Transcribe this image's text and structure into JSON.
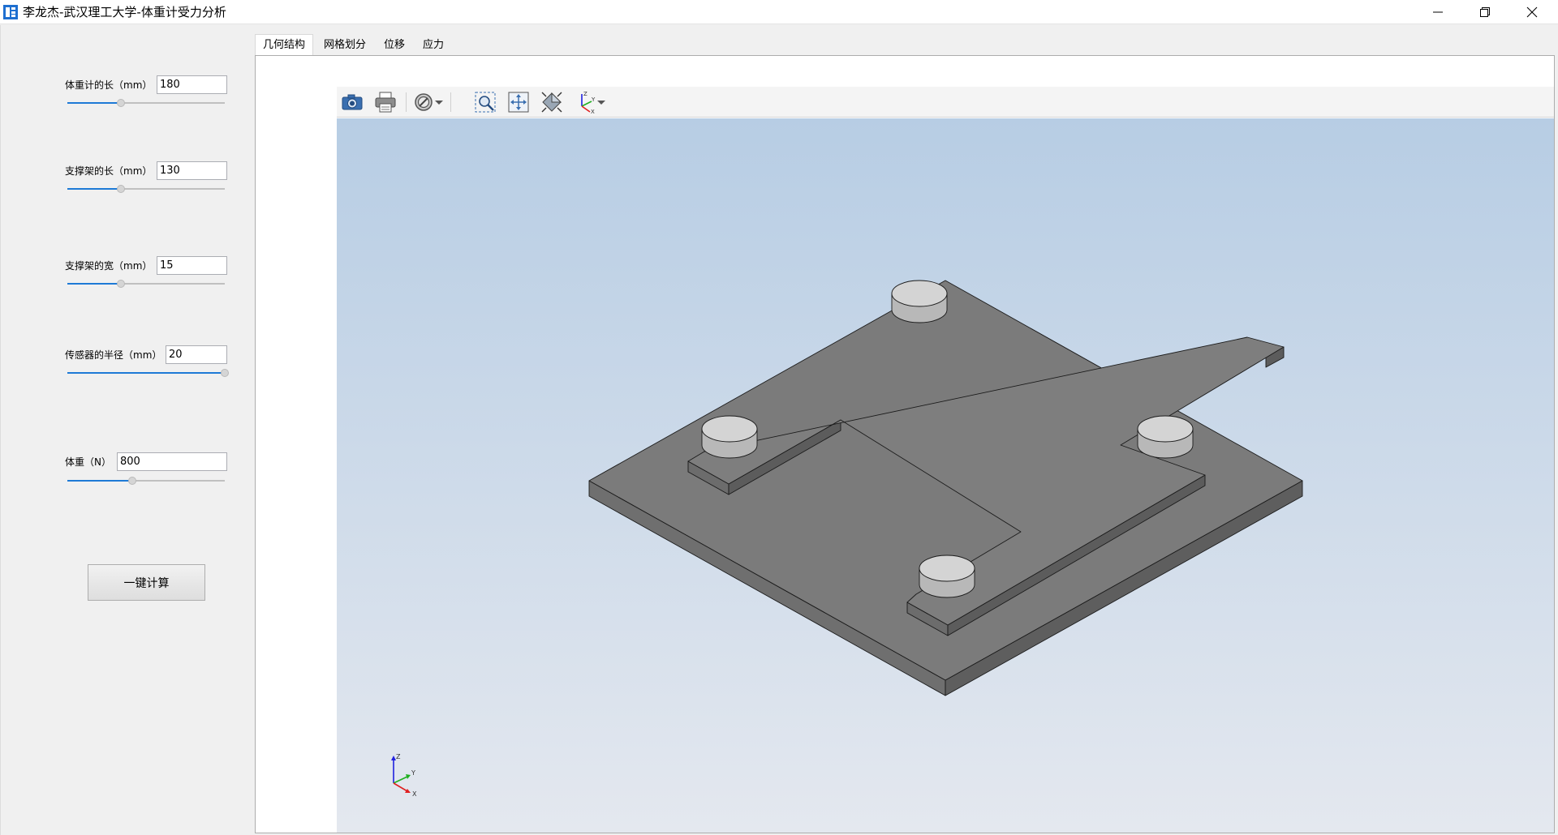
{
  "window": {
    "title": "李龙杰-武汉理工大学-体重计受力分析",
    "controls": {
      "minimize": "minimize",
      "maximize": "restore",
      "close": "close"
    }
  },
  "params": [
    {
      "label": "体重计的长（mm）",
      "value": "180",
      "slider_fraction": 0.34
    },
    {
      "label": "支撑架的长（mm）",
      "value": "130",
      "slider_fraction": 0.34
    },
    {
      "label": "支撑架的宽（mm）",
      "value": "15",
      "slider_fraction": 0.34
    },
    {
      "label": "传感器的半径（mm）",
      "value": "20",
      "slider_fraction": 1.0
    },
    {
      "label": "体重（N）",
      "value": "800",
      "slider_fraction": 0.41
    }
  ],
  "calc_button": {
    "label": "一键计算"
  },
  "tabs": [
    {
      "label": "几何结构",
      "active": true
    },
    {
      "label": "网格划分",
      "active": false
    },
    {
      "label": "位移",
      "active": false
    },
    {
      "label": "应力",
      "active": false
    }
  ],
  "viewer": {
    "toolbar": [
      "camera-icon",
      "print-icon",
      "clip-plane-icon",
      "dropdown-arrow-icon",
      "zoom-box-icon",
      "fit-all-icon",
      "isometric-view-icon",
      "axes-view-icon",
      "dropdown-arrow-icon"
    ],
    "axis_labels": {
      "x": "X",
      "y": "Y",
      "z": "Z"
    },
    "colors": {
      "background_top": "#b7cde4",
      "background_bottom": "#e4e8ef",
      "model_face": "#7d7d7d",
      "model_edge": "#1a1a1a",
      "axis_x": "#e02020",
      "axis_y": "#20b020",
      "axis_z": "#2020e0"
    }
  }
}
